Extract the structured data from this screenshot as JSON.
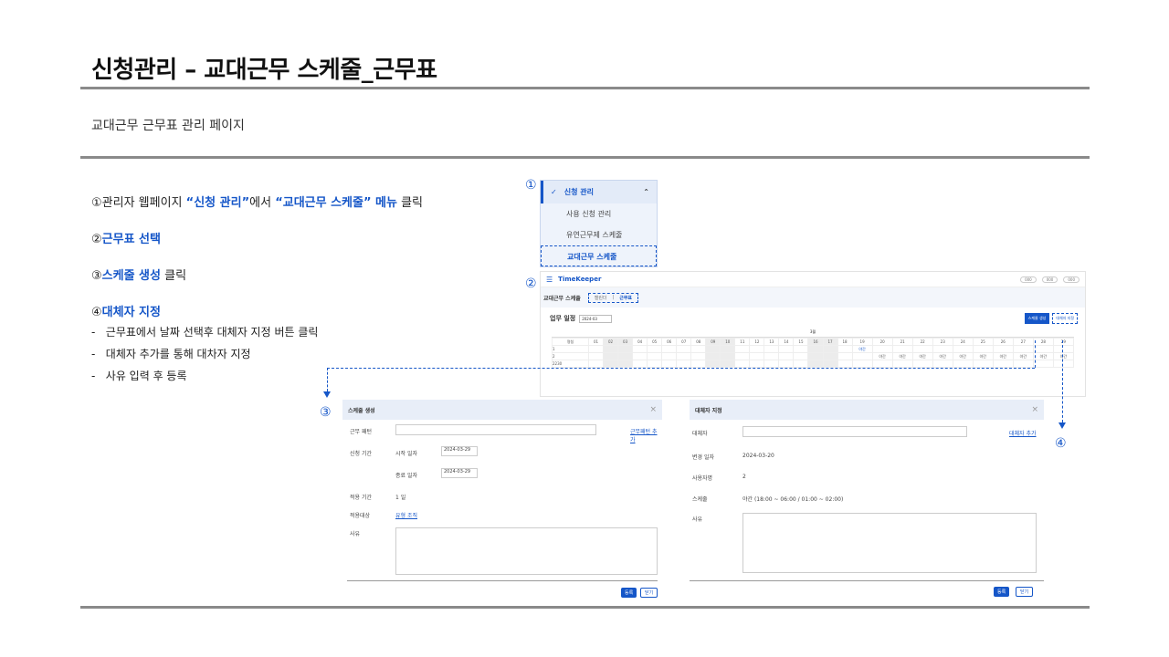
{
  "title": "신청관리 – 교대근무 스케줄_근무표",
  "subtitle": "교대근무 근무표 관리 페이지",
  "steps": [
    {
      "num": "①",
      "parts": [
        "관리자 웹페이지 ",
        "“신청 관리”",
        "에서 ",
        "“교대근무 스케줄” 메뉴",
        " 클릭"
      ]
    },
    {
      "num": "②",
      "parts": [
        "근무표 선택"
      ]
    },
    {
      "num": "③",
      "parts": [
        "스케줄 생성",
        " 클릭"
      ]
    },
    {
      "num": "④",
      "parts": [
        "대체자 지정"
      ]
    }
  ],
  "bullets": [
    "근무표에서 날짜 선택후 대체자 지정 버튼 클릭",
    "대체자 추가를 통해 대차자 지정",
    "사유 입력 후 등록"
  ],
  "markers": {
    "m1": "①",
    "m2": "②",
    "m3": "③",
    "m4": "④"
  },
  "menu": {
    "head": "신청 관리",
    "items": [
      "사용 신청 관리",
      "유연근무제 스케줄",
      "교대근무 스케줄"
    ]
  },
  "timekeeper": {
    "logo": "TimeKeeper",
    "util": [
      "000",
      "000",
      "000"
    ],
    "page": "교대근무 스케줄",
    "tabs": [
      "캘린더",
      "근무표"
    ],
    "work_label": "업무 일정",
    "date": "2024-03",
    "btn_create": "스케줄 생성",
    "btn_assign": "대체자 지정",
    "month": "3월",
    "col_head": "명칭",
    "days": [
      "01",
      "02",
      "03",
      "04",
      "05",
      "06",
      "07",
      "08",
      "09",
      "10",
      "11",
      "12",
      "13",
      "14",
      "15",
      "16",
      "17",
      "18",
      "19",
      "20",
      "21",
      "22",
      "23",
      "24",
      "25",
      "26",
      "27",
      "28",
      "29"
    ],
    "rows": [
      "1",
      "2",
      "2230"
    ],
    "shift_label": "야간",
    "selected_label": "야간"
  },
  "dlg_create": {
    "title": "스케줄 생성",
    "close": "×",
    "f_name": "근무 패턴",
    "link_add": "근무패턴 추가",
    "f_period": "신청 기간",
    "start_label": "시작 일자",
    "start_val": "2024-03-29",
    "end_label": "종료 일자",
    "end_val": "2024-03-29",
    "f_days": "적용 기간",
    "days_val": "1 일",
    "f_target": "적용대상",
    "target_links": "유형  조직",
    "f_reason": "사유",
    "btn_ok": "등록",
    "btn_close": "닫기"
  },
  "dlg_assign": {
    "title": "대체자 지정",
    "close": "×",
    "f_sub": "대체자",
    "link_add": "대체자 추가",
    "f_date": "변경 일자",
    "date_val": "2024-03-20",
    "f_person": "사용자명",
    "person_val": "2",
    "f_sched": "스케줄",
    "sched_val": "야간 (18:00 ~ 06:00 / 01:00 ~ 02:00)",
    "f_reason": "사유",
    "btn_ok": "등록",
    "btn_close": "닫기"
  }
}
